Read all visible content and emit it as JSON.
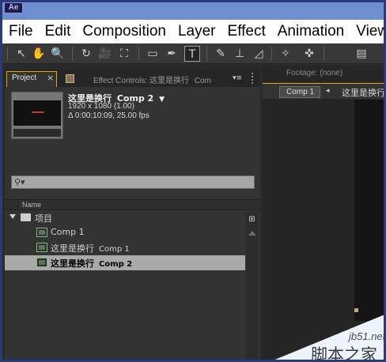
{
  "app": {
    "logo": "Ae"
  },
  "menu": [
    "File",
    "Edit",
    "Composition",
    "Layer",
    "Effect",
    "Animation",
    "View"
  ],
  "toolbar": {
    "tools": [
      "selection-tool",
      "hand-tool",
      "zoom-tool",
      "rotation-tool",
      "camera-tool",
      "pan-behind-tool",
      "rectangle-tool",
      "pen-tool",
      "type-tool",
      "brush-tool",
      "clone-stamp-tool",
      "eraser-tool",
      "roto-brush-tool",
      "puppet-pin-tool"
    ],
    "active_tool": "type-tool",
    "glyphs": [
      "↖",
      "✋",
      "🔍",
      "↻",
      "🎥",
      "⛶",
      "▭",
      "✒",
      "T",
      "✎",
      "⊥",
      "◿",
      "✧",
      "✜",
      "▤"
    ]
  },
  "project_panel": {
    "tab_label": "Project",
    "tab_close": "×",
    "effect_controls_tab": "Effect Controls: 这里是换行",
    "effect_controls_overflow": "Com",
    "panel_menu": "▾≡",
    "selected_item": {
      "name": "这里是换行",
      "comp": "Comp 2",
      "resolution": "1920 x 1080 (1.00)",
      "duration": "Δ 0:00:10:09, 25.00 fps"
    },
    "search_placeholder": "",
    "column_name": "Name",
    "items": [
      {
        "type": "folder",
        "label": "项目"
      },
      {
        "type": "comp",
        "label": "Comp 1"
      },
      {
        "type": "comp",
        "label": "这里是换行",
        "sub": "Comp 1"
      },
      {
        "type": "comp",
        "label": "这里是换行",
        "sub": "Comp 2",
        "selected": true
      }
    ]
  },
  "viewer_panel": {
    "footage_tab": "Footage: (none)",
    "comp_pill": "Comp 1",
    "arrow": "◂",
    "breadcrumb": "这里是换行"
  },
  "watermark": {
    "url": "jb51.net",
    "name": "脚本之家"
  }
}
